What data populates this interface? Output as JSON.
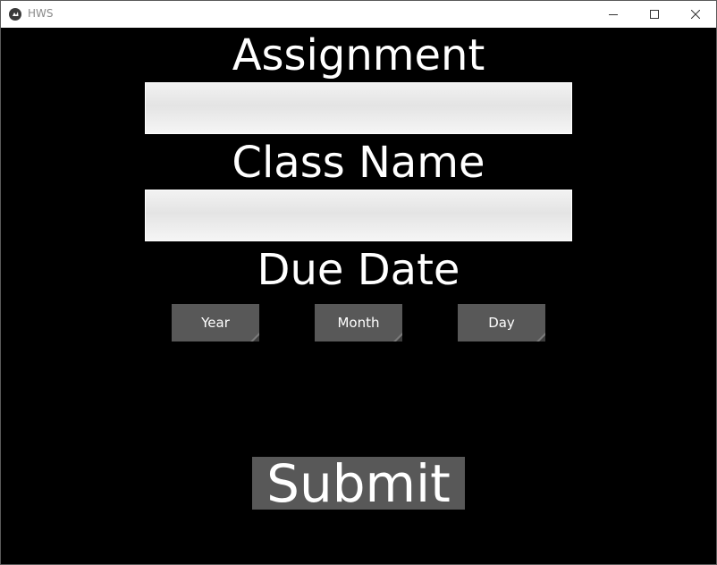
{
  "window": {
    "title": "HWS",
    "app_icon": "kivy-logo-icon",
    "controls": [
      "minimize-icon",
      "maximize-icon",
      "close-icon"
    ]
  },
  "form": {
    "assignment_label": "Assignment",
    "assignment_value": "",
    "class_name_label": "Class Name",
    "class_name_value": "",
    "due_date_label": "Due Date",
    "year_label": "Year",
    "month_label": "Month",
    "day_label": "Day",
    "submit_label": "Submit"
  },
  "colors": {
    "background": "#000000",
    "button": "#585858",
    "text": "#ffffff",
    "input": "#eeeeee"
  }
}
